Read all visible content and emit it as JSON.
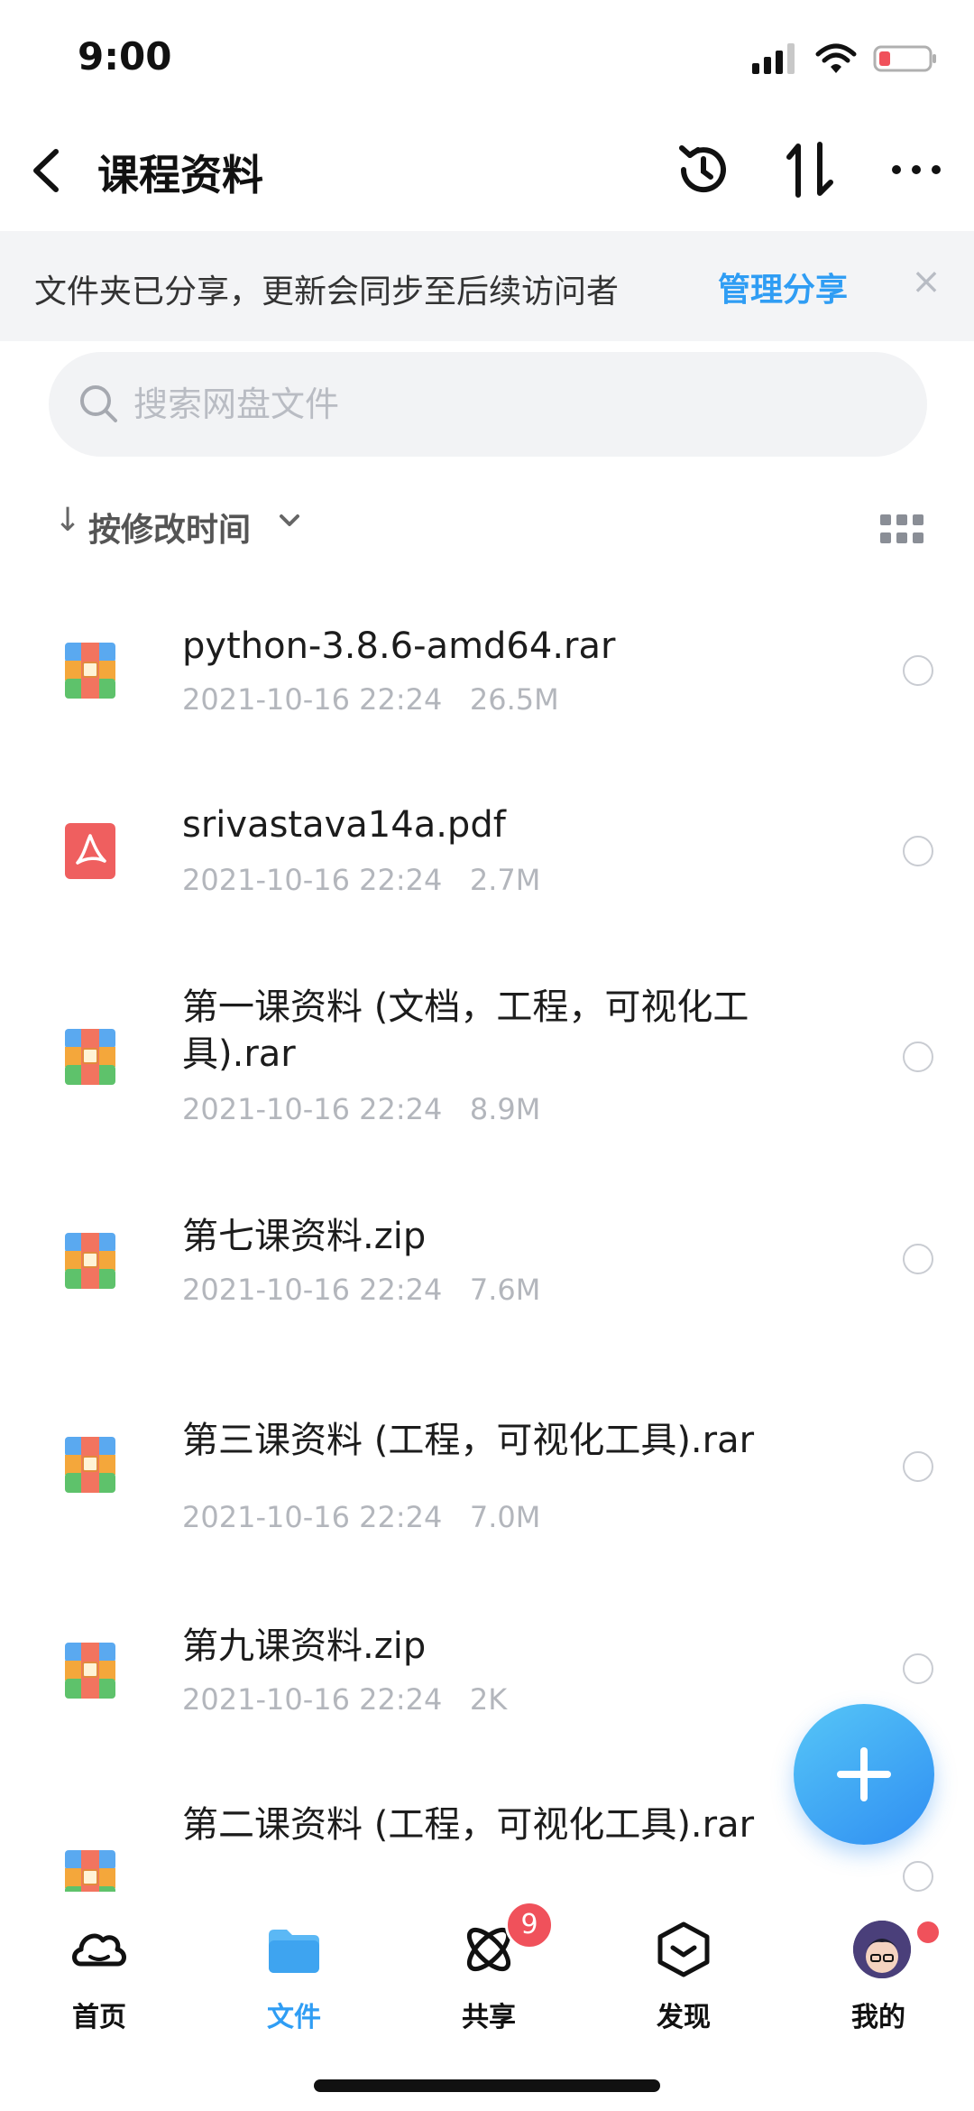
{
  "status": {
    "time": "9:00"
  },
  "nav": {
    "title": "课程资料"
  },
  "banner": {
    "text": "文件夹已分享，更新会同步至后续访问者",
    "link": "管理分享",
    "close": "×"
  },
  "search": {
    "placeholder": "搜索网盘文件",
    "value": ""
  },
  "sort": {
    "arrow": "↓",
    "label": "按修改时间"
  },
  "files": [
    {
      "name": "python-3.8.6-amd64.rar",
      "date": "2021-10-16 22:24",
      "size": "26.5M",
      "type": "archive"
    },
    {
      "name": "srivastava14a.pdf",
      "date": "2021-10-16 22:24",
      "size": "2.7M",
      "type": "pdf"
    },
    {
      "name": "第一课资料 (文档，工程，可视化工具).rar",
      "date": "2021-10-16 22:24",
      "size": "8.9M",
      "type": "archive"
    },
    {
      "name": "第七课资料.zip",
      "date": "2021-10-16 22:24",
      "size": "7.6M",
      "type": "archive"
    },
    {
      "name": "第三课资料 (工程，可视化工具).rar",
      "date": "2021-10-16 22:24",
      "size": "7.0M",
      "type": "archive"
    },
    {
      "name": "第九课资料.zip",
      "date": "2021-10-16 22:24",
      "size": "2K",
      "type": "archive"
    },
    {
      "name": "第二课资料 (工程，可视化工具).rar",
      "date": "",
      "size": "",
      "type": "archive"
    }
  ],
  "tabs": [
    {
      "label": "首页",
      "icon": "cloud-icon"
    },
    {
      "label": "文件",
      "icon": "folder-icon",
      "active": true
    },
    {
      "label": "共享",
      "icon": "atom-icon",
      "badge": "9"
    },
    {
      "label": "发现",
      "icon": "cube-icon"
    },
    {
      "label": "我的",
      "icon": "avatar"
    }
  ],
  "colors": {
    "accent": "#2f9df4",
    "badge": "#f0515b",
    "banner_bg": "#f3f4f6"
  }
}
